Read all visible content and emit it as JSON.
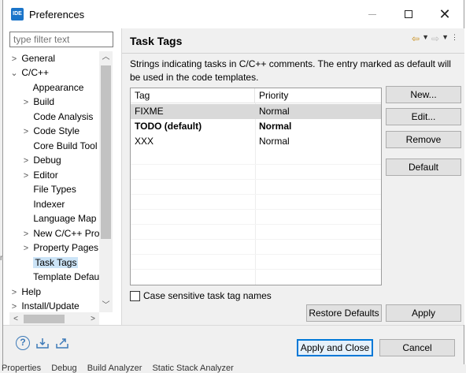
{
  "window": {
    "title": "Preferences",
    "app_icon_text": "IDE"
  },
  "filter": {
    "placeholder": "type filter text"
  },
  "tree": {
    "items": [
      {
        "label": "General",
        "twisty": ">",
        "level": 0
      },
      {
        "label": "C/C++",
        "twisty": "v",
        "level": 0
      },
      {
        "label": "Appearance",
        "twisty": "",
        "level": 1
      },
      {
        "label": "Build",
        "twisty": ">",
        "level": 1
      },
      {
        "label": "Code Analysis",
        "twisty": "",
        "level": 1
      },
      {
        "label": "Code Style",
        "twisty": ">",
        "level": 1
      },
      {
        "label": "Core Build Tool",
        "twisty": "",
        "level": 1
      },
      {
        "label": "Debug",
        "twisty": ">",
        "level": 1
      },
      {
        "label": "Editor",
        "twisty": ">",
        "level": 1
      },
      {
        "label": "File Types",
        "twisty": "",
        "level": 1
      },
      {
        "label": "Indexer",
        "twisty": "",
        "level": 1
      },
      {
        "label": "Language Map",
        "twisty": "",
        "level": 1
      },
      {
        "label": "New C/C++ Pro",
        "twisty": ">",
        "level": 1
      },
      {
        "label": "Property Pages",
        "twisty": ">",
        "level": 1
      },
      {
        "label": "Task Tags",
        "twisty": "",
        "level": 1,
        "selected": true
      },
      {
        "label": "Template Defau",
        "twisty": "",
        "level": 1
      },
      {
        "label": "Help",
        "twisty": ">",
        "level": 0
      },
      {
        "label": "Install/Update",
        "twisty": ">",
        "level": 0
      }
    ]
  },
  "page": {
    "title": "Task Tags",
    "description": "Strings indicating tasks in C/C++ comments. The entry marked as default will be used in the code templates."
  },
  "table": {
    "headers": [
      "Tag",
      "Priority"
    ],
    "rows": [
      {
        "tag": "FIXME",
        "priority": "Normal",
        "highlighted": true,
        "bold": false
      },
      {
        "tag": "TODO (default)",
        "priority": "Normal",
        "highlighted": false,
        "bold": true
      },
      {
        "tag": "XXX",
        "priority": "Normal",
        "highlighted": false,
        "bold": false
      }
    ]
  },
  "buttons": {
    "new": "New...",
    "edit": "Edit...",
    "remove": "Remove",
    "default": "Default",
    "restore_defaults": "Restore Defaults",
    "apply": "Apply",
    "apply_and_close": "Apply and Close",
    "cancel": "Cancel"
  },
  "checkbox": {
    "label": "Case sensitive task tag names",
    "checked": false
  },
  "background": {
    "tabs": [
      "Properties",
      "Debug",
      "Build Analyzer",
      "Static Stack Analyzer"
    ]
  }
}
